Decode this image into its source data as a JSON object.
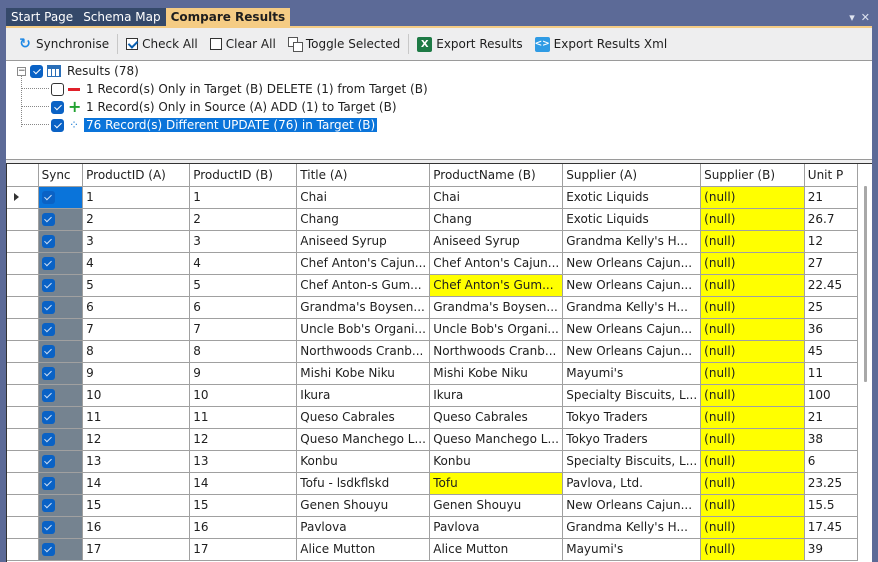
{
  "tabs": [
    {
      "label": "Start Page",
      "active": false
    },
    {
      "label": "Schema Map",
      "active": false
    },
    {
      "label": "Compare Results",
      "active": true
    }
  ],
  "tab_controls": {
    "dropdown": "▾",
    "close": "✕"
  },
  "toolbar": {
    "synchronise": "Synchronise",
    "check_all": "Check All",
    "clear_all": "Clear All",
    "toggle_selected": "Toggle Selected",
    "export_results": "Export Results",
    "export_results_xml": "Export Results Xml",
    "icons": {
      "sync": "↻",
      "excel": "X",
      "xml": "<>"
    }
  },
  "tree": {
    "root": {
      "label": "Results (78)",
      "checked": true,
      "expander": "−"
    },
    "children": [
      {
        "label": "1 Record(s) Only in Target (B) DELETE (1) from Target (B)",
        "checked": false,
        "icon": "delete"
      },
      {
        "label": "1 Record(s) Only in Source (A) ADD (1) to Target (B)",
        "checked": true,
        "icon": "add",
        "icon_glyph": "+"
      },
      {
        "label": "76 Record(s) Different UPDATE (76) in Target (B)",
        "checked": true,
        "icon": "update",
        "icon_glyph": "⁘",
        "selected": true
      }
    ]
  },
  "grid": {
    "columns": [
      "Sync",
      "ProductID (A)",
      "ProductID (B)",
      "Title (A)",
      "ProductName (B)",
      "Supplier (A)",
      "Supplier (B)",
      "Unit P"
    ],
    "highlight_color": "#ffff00",
    "rows": [
      {
        "sync": true,
        "pid_a": "1",
        "pid_b": "1",
        "title_a": "Chai",
        "name_b": "Chai",
        "sup_a": "Exotic Liquids",
        "sup_b": "(null)",
        "unit": "21",
        "name_diff": false,
        "current": true
      },
      {
        "sync": true,
        "pid_a": "2",
        "pid_b": "2",
        "title_a": "Chang",
        "name_b": "Chang",
        "sup_a": "Exotic Liquids",
        "sup_b": "(null)",
        "unit": "26.7",
        "name_diff": false
      },
      {
        "sync": true,
        "pid_a": "3",
        "pid_b": "3",
        "title_a": "Aniseed Syrup",
        "name_b": "Aniseed Syrup",
        "sup_a": "Grandma Kelly's H...",
        "sup_b": "(null)",
        "unit": "12",
        "name_diff": false
      },
      {
        "sync": true,
        "pid_a": "4",
        "pid_b": "4",
        "title_a": "Chef Anton's Cajun...",
        "name_b": "Chef Anton's Cajun...",
        "sup_a": "New Orleans Cajun...",
        "sup_b": "(null)",
        "unit": "27",
        "name_diff": false
      },
      {
        "sync": true,
        "pid_a": "5",
        "pid_b": "5",
        "title_a": "Chef Anton-s Gum...",
        "name_b": "Chef Anton's Gum...",
        "sup_a": "New Orleans Cajun...",
        "sup_b": "(null)",
        "unit": "22.45",
        "name_diff": true
      },
      {
        "sync": true,
        "pid_a": "6",
        "pid_b": "6",
        "title_a": "Grandma's Boysen...",
        "name_b": "Grandma's Boysen...",
        "sup_a": "Grandma Kelly's H...",
        "sup_b": "(null)",
        "unit": "25",
        "name_diff": false
      },
      {
        "sync": true,
        "pid_a": "7",
        "pid_b": "7",
        "title_a": "Uncle Bob's Organi...",
        "name_b": "Uncle Bob's Organi...",
        "sup_a": "New Orleans Cajun...",
        "sup_b": "(null)",
        "unit": "36",
        "name_diff": false
      },
      {
        "sync": true,
        "pid_a": "8",
        "pid_b": "8",
        "title_a": "Northwoods Cranb...",
        "name_b": "Northwoods Cranb...",
        "sup_a": "New Orleans Cajun...",
        "sup_b": "(null)",
        "unit": "45",
        "name_diff": false
      },
      {
        "sync": true,
        "pid_a": "9",
        "pid_b": "9",
        "title_a": "Mishi Kobe Niku",
        "name_b": "Mishi Kobe Niku",
        "sup_a": "Mayumi's",
        "sup_b": "(null)",
        "unit": "11",
        "name_diff": false
      },
      {
        "sync": true,
        "pid_a": "10",
        "pid_b": "10",
        "title_a": "Ikura",
        "name_b": "Ikura",
        "sup_a": "Specialty Biscuits, L...",
        "sup_b": "(null)",
        "unit": "100",
        "name_diff": false
      },
      {
        "sync": true,
        "pid_a": "11",
        "pid_b": "11",
        "title_a": "Queso Cabrales",
        "name_b": "Queso Cabrales",
        "sup_a": "Tokyo Traders",
        "sup_b": "(null)",
        "unit": "21",
        "name_diff": false
      },
      {
        "sync": true,
        "pid_a": "12",
        "pid_b": "12",
        "title_a": "Queso Manchego L...",
        "name_b": "Queso Manchego L...",
        "sup_a": "Tokyo Traders",
        "sup_b": "(null)",
        "unit": "38",
        "name_diff": false
      },
      {
        "sync": true,
        "pid_a": "13",
        "pid_b": "13",
        "title_a": "Konbu",
        "name_b": "Konbu",
        "sup_a": "Specialty Biscuits, L...",
        "sup_b": "(null)",
        "unit": "6",
        "name_diff": false
      },
      {
        "sync": true,
        "pid_a": "14",
        "pid_b": "14",
        "title_a": "Tofu - lsdkflskd",
        "name_b": "Tofu",
        "sup_a": "Pavlova, Ltd.",
        "sup_b": "(null)",
        "unit": "23.25",
        "name_diff": true
      },
      {
        "sync": true,
        "pid_a": "15",
        "pid_b": "15",
        "title_a": "Genen Shouyu",
        "name_b": "Genen Shouyu",
        "sup_a": "New Orleans Cajun...",
        "sup_b": "(null)",
        "unit": "15.5",
        "name_diff": false
      },
      {
        "sync": true,
        "pid_a": "16",
        "pid_b": "16",
        "title_a": "Pavlova",
        "name_b": "Pavlova",
        "sup_a": "Grandma Kelly's H...",
        "sup_b": "(null)",
        "unit": "17.45",
        "name_diff": false
      },
      {
        "sync": true,
        "pid_a": "17",
        "pid_b": "17",
        "title_a": "Alice Mutton",
        "name_b": "Alice Mutton",
        "sup_a": "Mayumi's",
        "sup_b": "(null)",
        "unit": "39",
        "name_diff": false
      }
    ]
  }
}
